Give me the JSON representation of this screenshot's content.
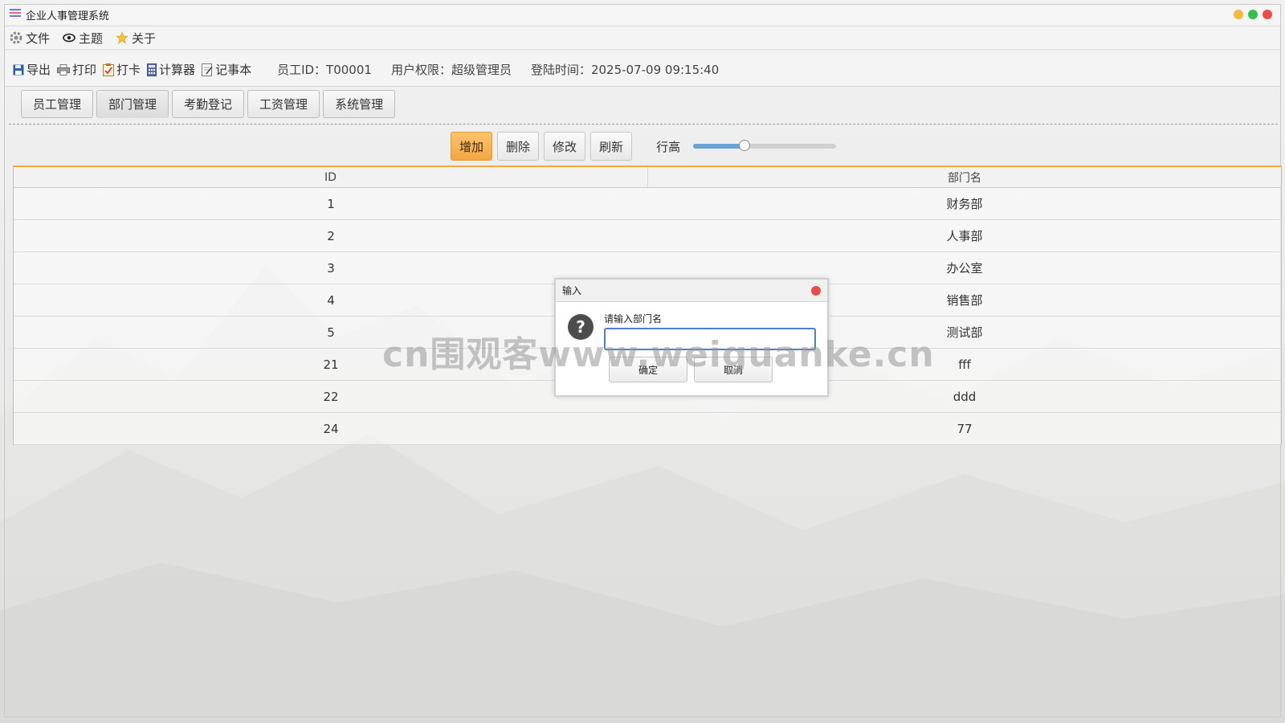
{
  "window": {
    "title": "企业人事管理系统",
    "controls": {
      "min_color": "#f5b942",
      "max_color": "#35c04a",
      "close_color": "#ee4a4a"
    }
  },
  "menubar": {
    "items": [
      {
        "label": "文件",
        "icon": "gear-icon"
      },
      {
        "label": "主题",
        "icon": "eye-icon"
      },
      {
        "label": "关于",
        "icon": "star-icon"
      }
    ]
  },
  "toolbar": {
    "items": [
      {
        "label": "导出",
        "icon": "save-icon"
      },
      {
        "label": "打印",
        "icon": "printer-icon"
      },
      {
        "label": "打卡",
        "icon": "clipboard-check-icon"
      },
      {
        "label": "计算器",
        "icon": "calculator-icon"
      },
      {
        "label": "记事本",
        "icon": "notepad-icon"
      }
    ],
    "employee_id": "员工ID：T00001",
    "permission": "用户权限：超级管理员",
    "login_time": "登陆时间：2025-07-09 09:15:40"
  },
  "tabs": [
    {
      "label": "员工管理",
      "active": false
    },
    {
      "label": "部门管理",
      "active": true
    },
    {
      "label": "考勤登记",
      "active": false
    },
    {
      "label": "工资管理",
      "active": false
    },
    {
      "label": "系统管理",
      "active": false
    }
  ],
  "actions": {
    "add": "增加",
    "delete": "删除",
    "edit": "修改",
    "refresh": "刷新",
    "row_height_label": "行高",
    "row_height_value": 0.36,
    "accent_color": "#f4a940"
  },
  "table": {
    "columns": [
      "ID",
      "部门名"
    ],
    "rows": [
      [
        "1",
        "财务部"
      ],
      [
        "2",
        "人事部"
      ],
      [
        "3",
        "办公室"
      ],
      [
        "4",
        "销售部"
      ],
      [
        "5",
        "测试部"
      ],
      [
        "21",
        "fff"
      ],
      [
        "22",
        "ddd"
      ],
      [
        "24",
        "77"
      ]
    ]
  },
  "dialog": {
    "title": "输入",
    "prompt": "请输入部门名",
    "input_value": "",
    "ok": "确定",
    "cancel": "取消",
    "icon": "question-icon"
  },
  "watermark": "cn围观客www.weiguanke.cn"
}
